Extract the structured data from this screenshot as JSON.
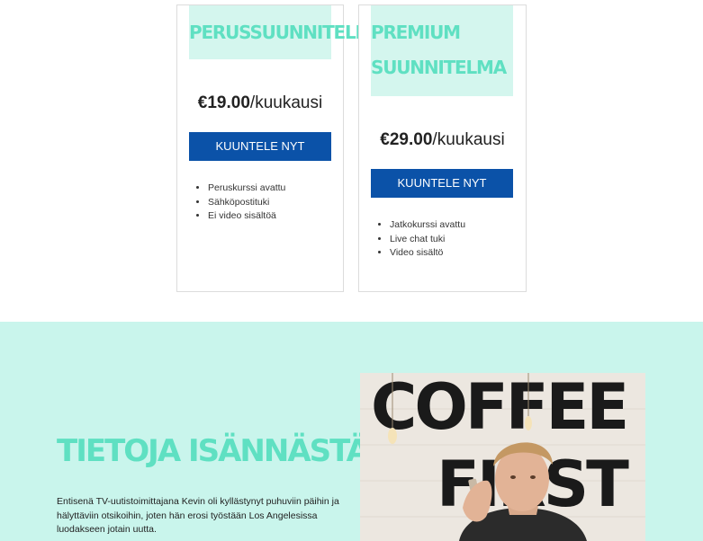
{
  "plans": [
    {
      "title": "PERUSSUUNNITELMA",
      "price_amount": "€19.00",
      "price_period": "/kuukausi",
      "cta_label": "KUUNTELE NYT",
      "features": [
        "Peruskurssi avattu",
        "Sähköpostituki",
        "Ei video sisältöä"
      ]
    },
    {
      "title": "PREMIUM SUUNNITELMA",
      "price_amount": "€29.00",
      "price_period": "/kuukausi",
      "cta_label": "KUUNTELE NYT",
      "features": [
        "Jatkokurssi avattu",
        "Live chat tuki",
        "Video sisältö"
      ]
    }
  ],
  "about": {
    "heading": "TIETOJA ISÄNNÄSTÄ",
    "text": "Entisenä TV-uutistoimittajana Kevin oli kyllästynyt puhuviin päihin ja hälyttäviin otsikoihin, joten hän erosi työstään Los Angelesissa luodakseen jotain uutta.",
    "photo_sign_line1": "COFFEE",
    "photo_sign_line2": "FIRST"
  },
  "colors": {
    "accent_mint": "#5fe0c2",
    "section_bg": "#c9f5ec",
    "title_bg": "#d4f6ee",
    "button_blue": "#0b52a8"
  }
}
